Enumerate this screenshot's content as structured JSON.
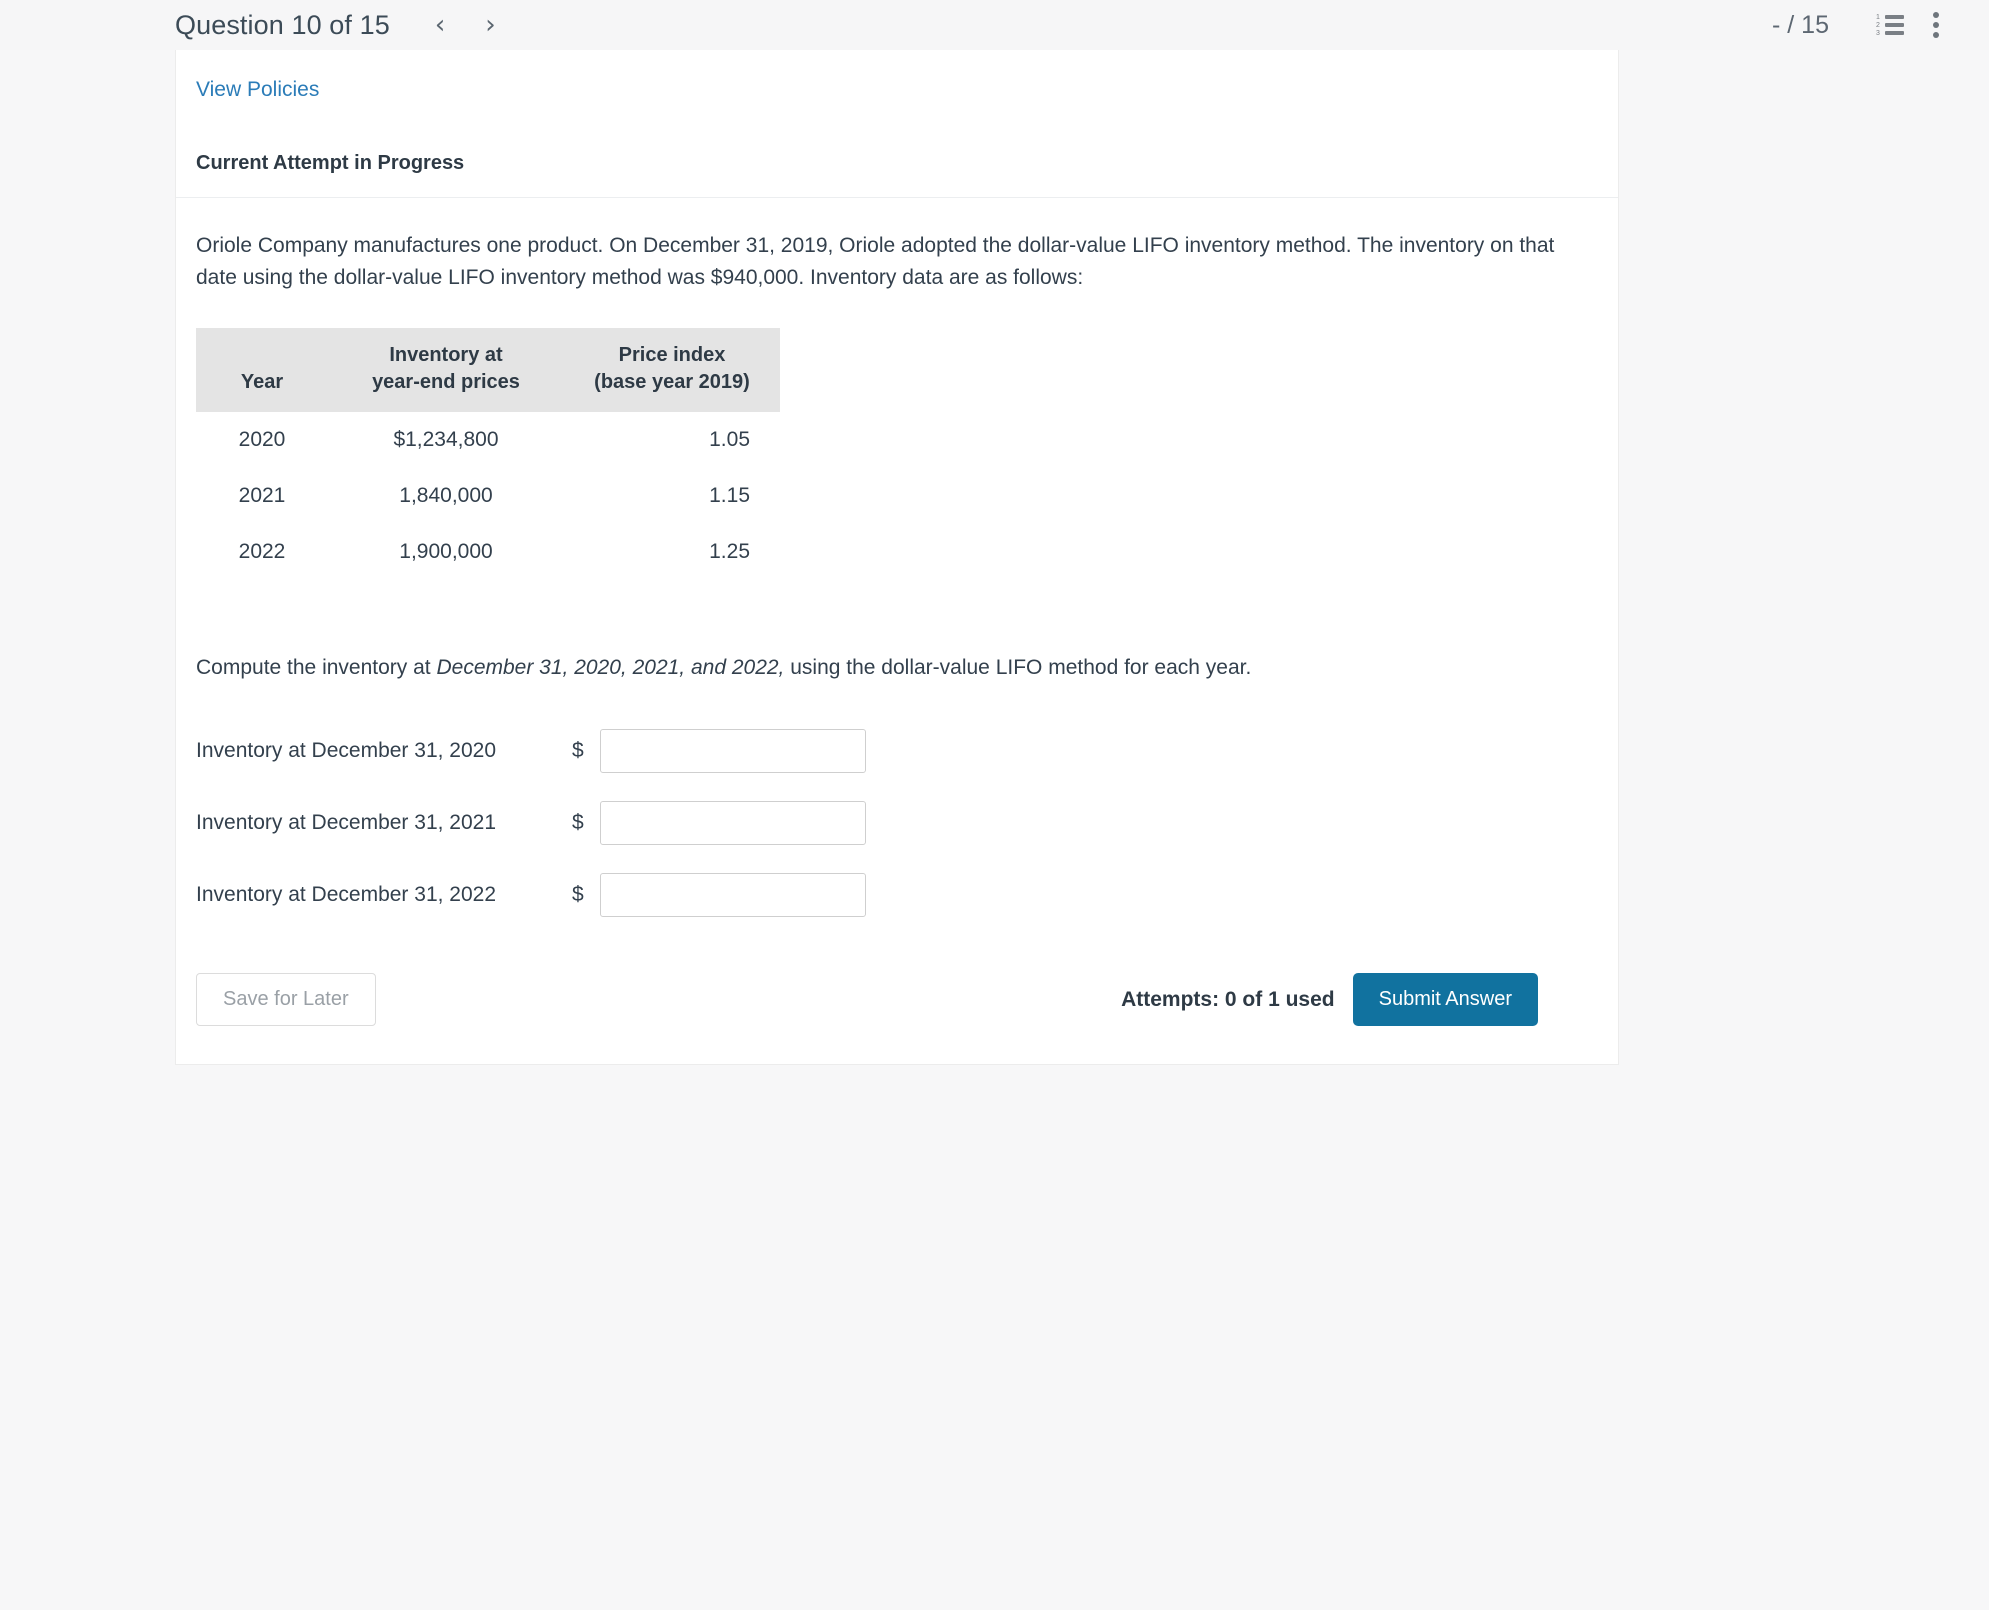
{
  "header": {
    "question_label": "Question 10 of 15",
    "prev_arrow": "‹",
    "next_arrow": "›",
    "score": "- / 15",
    "list_icon_name": "numbered-list-icon",
    "menu_icon_name": "kebab-menu-icon",
    "list_numbers": [
      "1",
      "2",
      "3"
    ]
  },
  "card": {
    "view_policies": "View Policies",
    "attempt_heading": "Current Attempt in Progress",
    "question_text": "Oriole Company manufactures one product. On December 31, 2019, Oriole adopted the dollar-value LIFO inventory method. The inventory on that date using the dollar-value LIFO inventory method was $940,000. Inventory data are as follows:",
    "compute_prefix": "Compute the inventory at ",
    "compute_italic": "December 31, 2020, 2021, and 2022,",
    "compute_suffix": " using the dollar-value LIFO method for each year."
  },
  "table": {
    "headers": {
      "year": "Year",
      "inventory_line1": "Inventory at",
      "inventory_line2": "year-end prices",
      "index_line1": "Price index",
      "index_line2": "(base year 2019)"
    },
    "rows": [
      {
        "year": "2020",
        "inventory": "$1,234,800",
        "index": "1.05"
      },
      {
        "year": "2021",
        "inventory": "1,840,000",
        "index": "1.15"
      },
      {
        "year": "2022",
        "inventory": "1,900,000",
        "index": "1.25"
      }
    ]
  },
  "answers": {
    "dollar_sign": "$",
    "rows": [
      {
        "label": "Inventory at December 31, 2020",
        "value": ""
      },
      {
        "label": "Inventory at December 31, 2021",
        "value": ""
      },
      {
        "label": "Inventory at December 31, 2022",
        "value": ""
      }
    ]
  },
  "footer": {
    "save_label": "Save for Later",
    "attempts": "Attempts: 0 of 1 used",
    "submit_label": "Submit Answer"
  },
  "colors": {
    "link_blue": "#2b7cb8",
    "submit_blue": "#11729f",
    "table_header_gray": "#e4e4e4",
    "page_background": "#f7f7f8"
  }
}
